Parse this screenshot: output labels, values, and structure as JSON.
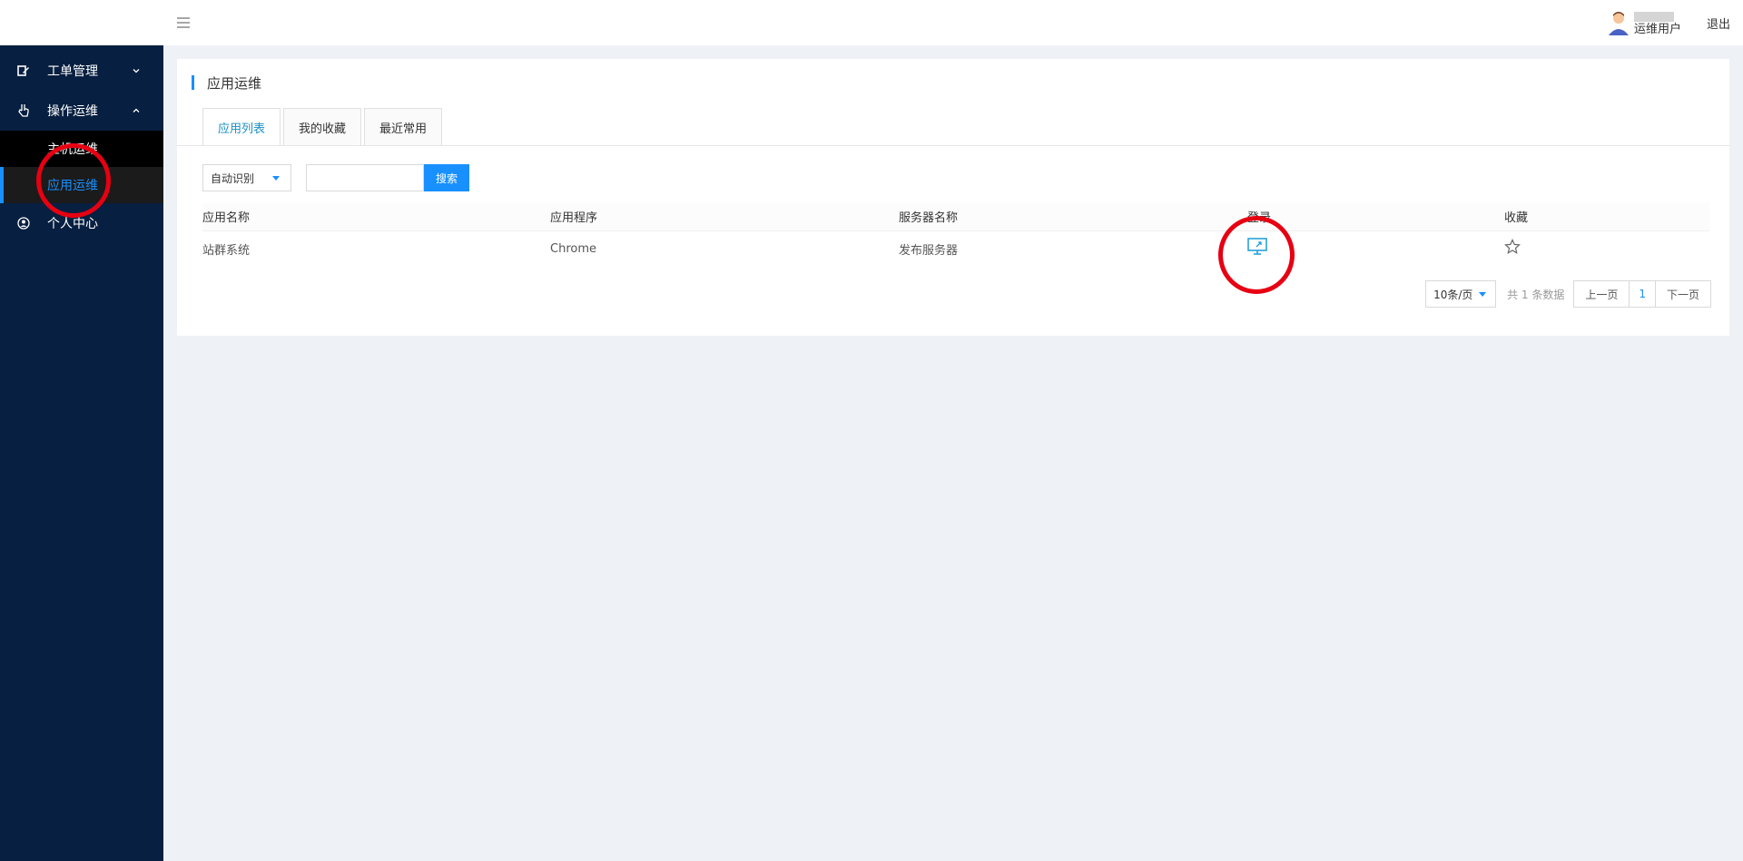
{
  "sidebar": {
    "menu": [
      {
        "label": "工单管理",
        "icon": "edit-icon",
        "arrow": "chevron-down-icon"
      },
      {
        "label": "操作运维",
        "icon": "hand-pointer-icon",
        "arrow": "chevron-up-icon"
      }
    ],
    "submenu": [
      {
        "label": "主机运维"
      },
      {
        "label": "应用运维"
      }
    ],
    "personal": {
      "label": "个人中心",
      "icon": "user-circle-icon"
    }
  },
  "header": {
    "user_name": "运维用户",
    "logout": "退出"
  },
  "card": {
    "title": "应用运维",
    "tabs": [
      "应用列表",
      "我的收藏",
      "最近常用"
    ],
    "filter": {
      "select_value": "自动识别",
      "search_placeholder": "",
      "search_button": "搜索"
    },
    "table": {
      "headers": [
        "应用名称",
        "应用程序",
        "服务器名称",
        "登录",
        "收藏"
      ],
      "rows": [
        {
          "name": "站群系统",
          "program": "Chrome",
          "server": "发布服务器",
          "login_icon": "remote-desktop-icon",
          "fav_icon": "star-outline-icon"
        }
      ]
    },
    "pager": {
      "page_size": "10条/页",
      "total": "共 1 条数据",
      "prev": "上一页",
      "current": "1",
      "next": "下一页"
    }
  },
  "colors": {
    "sidebar_bg": "#071f40",
    "accent": "#1890ff",
    "annotation": "#e60012"
  }
}
